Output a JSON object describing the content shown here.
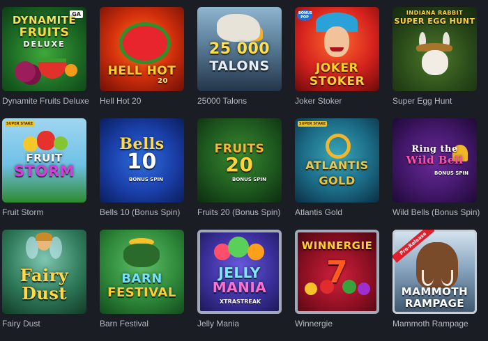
{
  "games": [
    {
      "caption": "Dynamite Fruits Deluxe",
      "art_line1": "DYNAMITE",
      "art_line2": "FRUITS",
      "art_line3": "DELUXE",
      "badge": "GA",
      "icon": "fruits-icon"
    },
    {
      "caption": "Hell Hot 20",
      "art_line1": "HELL HOT",
      "art_line2": "20",
      "icon": "watermelon-icon"
    },
    {
      "caption": "25000 Talons",
      "art_line1": "25 000",
      "art_line2": "TALONS",
      "icon": "eagle-icon"
    },
    {
      "caption": "Joker Stoker",
      "art_line1": "JOKER",
      "art_line2": "STOKER",
      "badge": "BONUS POP",
      "icon": "joker-icon"
    },
    {
      "caption": "Super Egg Hunt",
      "art_line1": "INDIANA RABBIT",
      "art_line2": "SUPER EGG HUNT",
      "icon": "rabbit-icon"
    },
    {
      "caption": "Fruit Storm",
      "art_line1": "FRUIT",
      "art_line2": "STORM",
      "badge": "SUPER STAKE",
      "icon": "fruits-icon"
    },
    {
      "caption": "Bells 10 (Bonus Spin)",
      "art_line1": "Bells",
      "art_line2": "10",
      "art_line3": "BONUS SPIN",
      "icon": "bell-icon"
    },
    {
      "caption": "Fruits 20 (Bonus Spin)",
      "art_line1": "FRUITS",
      "art_line2": "20",
      "art_line3": "BONUS SPIN",
      "icon": "fruits-icon"
    },
    {
      "caption": "Atlantis Gold",
      "art_line1": "ATLANTIS",
      "art_line2": "GOLD",
      "badge": "SUPER STAKE",
      "icon": "ring-icon"
    },
    {
      "caption": "Wild Bells (Bonus Spin)",
      "art_line1": "Ring the",
      "art_line2": "Wild Bell",
      "art_line3": "BONUS SPIN",
      "icon": "bell-icon"
    },
    {
      "caption": "Fairy Dust",
      "art_line1": "Fairy",
      "art_line2": "Dust",
      "icon": "fairy-icon"
    },
    {
      "caption": "Barn Festival",
      "art_line1": "BARN",
      "art_line2": "FESTIVAL",
      "icon": "pot-of-gold-icon"
    },
    {
      "caption": "Jelly Mania",
      "art_line1": "JELLY",
      "art_line2": "MANIA",
      "art_line3": "XTRASTREAK",
      "icon": "jelly-icon"
    },
    {
      "caption": "Winnergie",
      "art_line1": "WINNERGIE",
      "art_line2": "7",
      "icon": "seven-icon"
    },
    {
      "caption": "Mammoth Rampage",
      "art_line1": "MAMMOTH",
      "art_line2": "RAMPAGE",
      "badge": "Pre-Release",
      "icon": "mammoth-icon"
    }
  ],
  "colors": {
    "page_bg": "#1b1d24",
    "caption_text": "#b6b9c2"
  }
}
